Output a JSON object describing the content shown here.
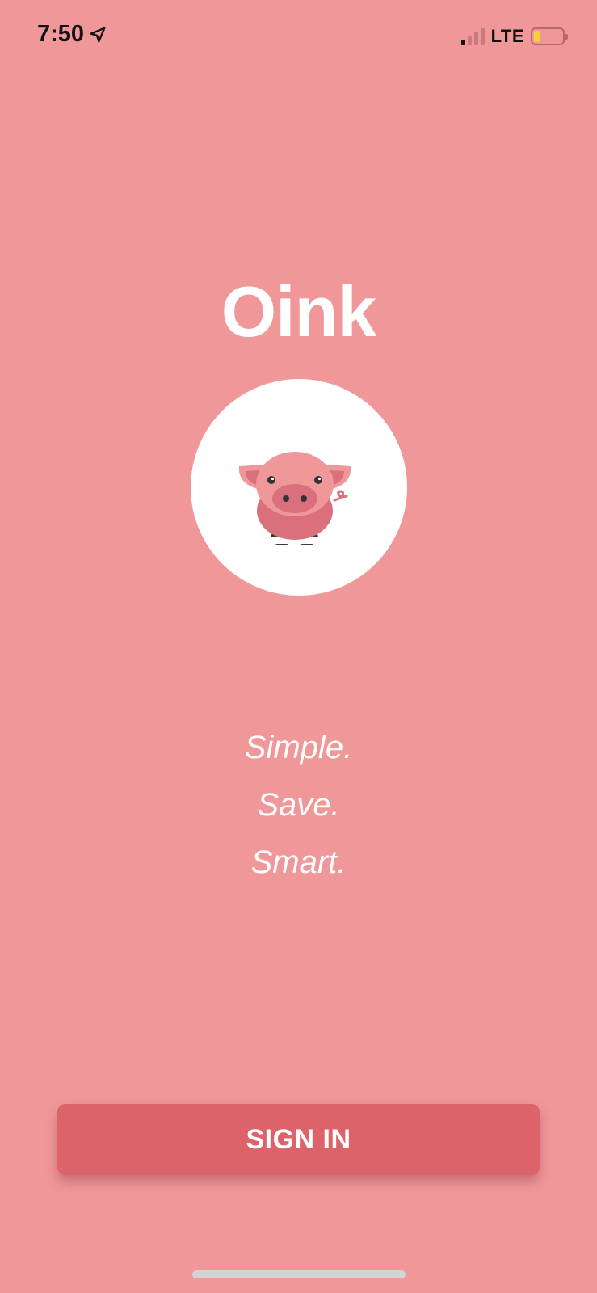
{
  "status_bar": {
    "time": "7:50",
    "network": "LTE",
    "location_icon": "location-arrow-icon",
    "signal_icon": "cellular-signal-icon",
    "battery_icon": "battery-low-icon",
    "battery_level": 0.2
  },
  "app": {
    "title": "Oink",
    "logo_icon": "pig-icon"
  },
  "taglines": [
    "Simple.",
    "Save.",
    "Smart."
  ],
  "actions": {
    "sign_in_label": "SIGN IN"
  },
  "colors": {
    "background": "#F0979A",
    "button": "#DC6369",
    "pig_body": "#F0979A",
    "pig_belly": "#D9707B"
  }
}
